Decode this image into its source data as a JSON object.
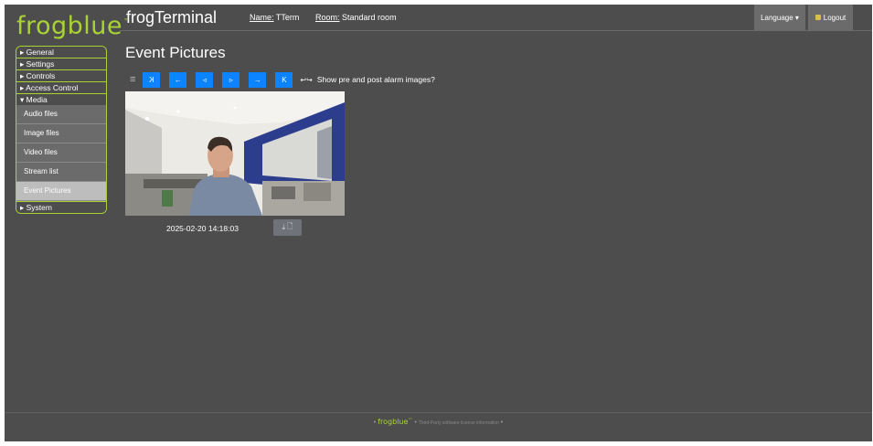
{
  "brand": {
    "logo": "frogblue",
    "tm": "™",
    "accent": "#a9d335"
  },
  "header": {
    "title": "frogTerminal",
    "name_label": "Name:",
    "name_value": "TTerm",
    "room_label": "Room:",
    "room_value": "Standard room",
    "language_label": "Language ▾",
    "logout_label": "Logout"
  },
  "sidebar": {
    "sections": [
      {
        "label": "▸ General"
      },
      {
        "label": "▸ Settings"
      },
      {
        "label": "▸ Controls"
      },
      {
        "label": "▸ Access Control"
      },
      {
        "label": "▾ Media"
      }
    ],
    "media_items": [
      {
        "label": "Audio files"
      },
      {
        "label": "Image files"
      },
      {
        "label": "Video files"
      },
      {
        "label": "Stream list"
      },
      {
        "label": "Event Pictures"
      }
    ],
    "system": {
      "label": "▸ System"
    }
  },
  "main": {
    "title": "Event Pictures",
    "toolbar": {
      "menu_icon": "≡",
      "first": "K",
      "prev": "←",
      "step_back": "◃",
      "step_forward": "▹",
      "next": "→",
      "last": "K",
      "toggle_icon": "↩↪",
      "toggle_label": "Show pre and post alarm images?"
    },
    "event": {
      "timestamp": "2025-02-20 14:18:03",
      "download_icon": "⤓",
      "file_icon": "🗋"
    }
  },
  "footer": {
    "brand": "frogblue",
    "tm": "™",
    "link": "Third-Party software license information",
    "sep": "•"
  }
}
